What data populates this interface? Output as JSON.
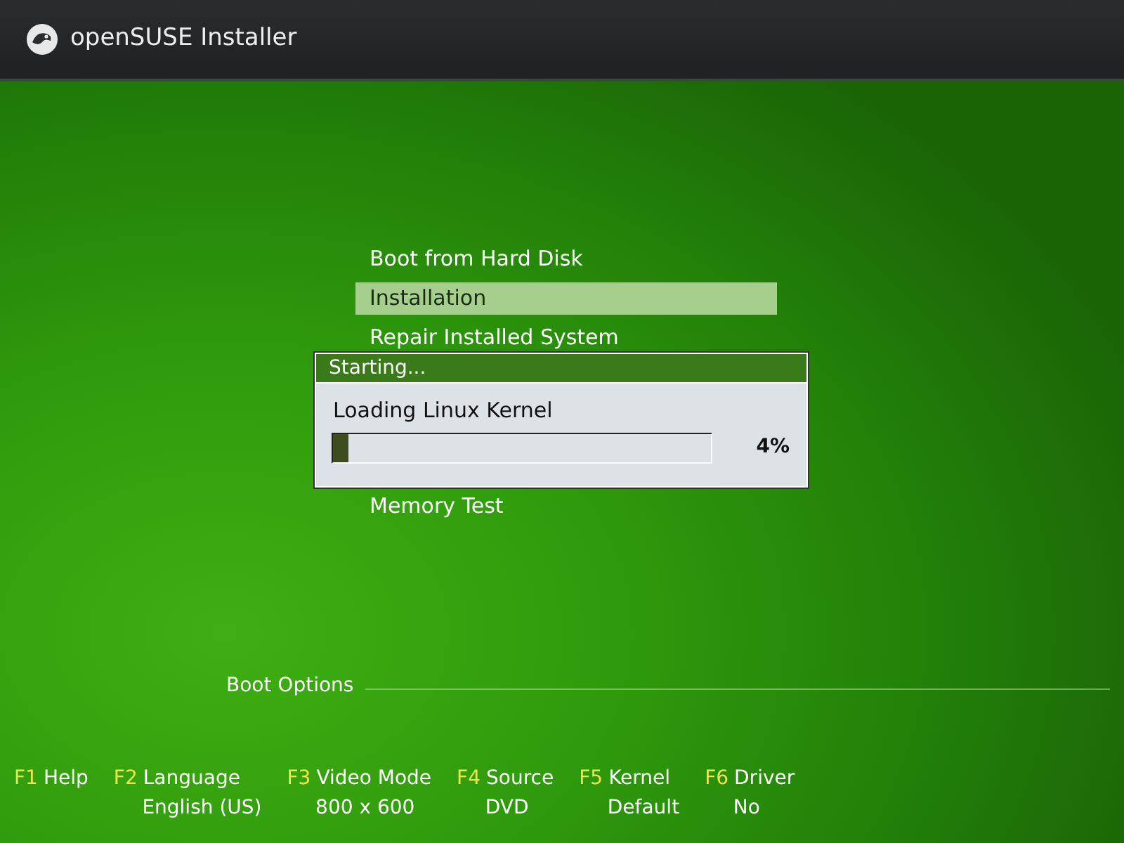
{
  "header": {
    "title": "openSUSE Installer"
  },
  "menu": [
    {
      "label": "Boot from Hard Disk",
      "selected": false
    },
    {
      "label": "Installation",
      "selected": true
    },
    {
      "label": "Repair Installed System",
      "selected": false
    },
    {
      "label": "Memory Test",
      "selected": false
    }
  ],
  "dialog": {
    "title": "Starting...",
    "message": "Loading Linux Kernel",
    "level": 0.04,
    "reading": "4%"
  },
  "boot_options": {
    "label": "Boot Options"
  },
  "function_keys": [
    {
      "key": "F1",
      "label": "Help"
    },
    {
      "key": "F2",
      "label": "Language",
      "value": "English (US)"
    },
    {
      "key": "F3",
      "label": "Video Mode",
      "value": "800 x 600"
    },
    {
      "key": "F4",
      "label": "Source",
      "value": "DVD"
    },
    {
      "key": "F5",
      "label": "Kernel",
      "value": "Default"
    },
    {
      "key": "F6",
      "label": "Driver",
      "value": "No"
    }
  ]
}
